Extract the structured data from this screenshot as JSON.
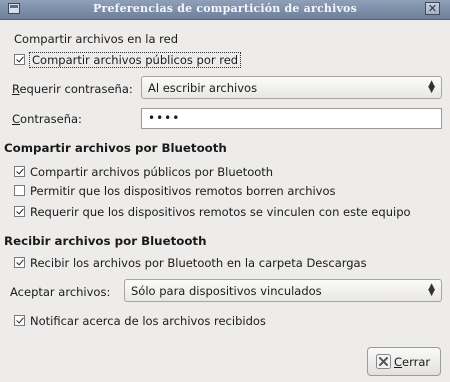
{
  "window": {
    "title": "Preferencias de compartición de archivos"
  },
  "network": {
    "section_title": "Compartir archivos en la red",
    "share_public": {
      "label": "Compartir archivos públicos por red",
      "checked": true
    },
    "require_password": {
      "label": "Requerir contraseña:",
      "value": "Al escribir archivos"
    },
    "password": {
      "label": "Contraseña:",
      "value": "••••"
    }
  },
  "bluetooth_share": {
    "section_title": "Compartir archivos por Bluetooth",
    "options": [
      {
        "label": "Compartir archivos públicos por Bluetooth",
        "checked": true
      },
      {
        "label": "Permitir que los dispositivos remotos borren archivos",
        "checked": false
      },
      {
        "label": "Requerir que los dispositivos remotos se vinculen con este equipo",
        "checked": true
      }
    ]
  },
  "bluetooth_receive": {
    "section_title": "Recibir archivos por Bluetooth",
    "receive_downloads": {
      "label": "Recibir los archivos por Bluetooth en la carpeta Descargas",
      "checked": true
    },
    "accept": {
      "label": "Aceptar archivos:",
      "value": "Sólo para dispositivos vinculados"
    },
    "notify": {
      "label": "Notificar acerca de los archivos recibidos",
      "checked": true
    }
  },
  "footer": {
    "close_label": "Cerrar"
  },
  "icons": {
    "window": "window-icon",
    "close": "close-icon",
    "cancel": "cancel-x-icon",
    "combo": "updown-arrows-icon"
  }
}
